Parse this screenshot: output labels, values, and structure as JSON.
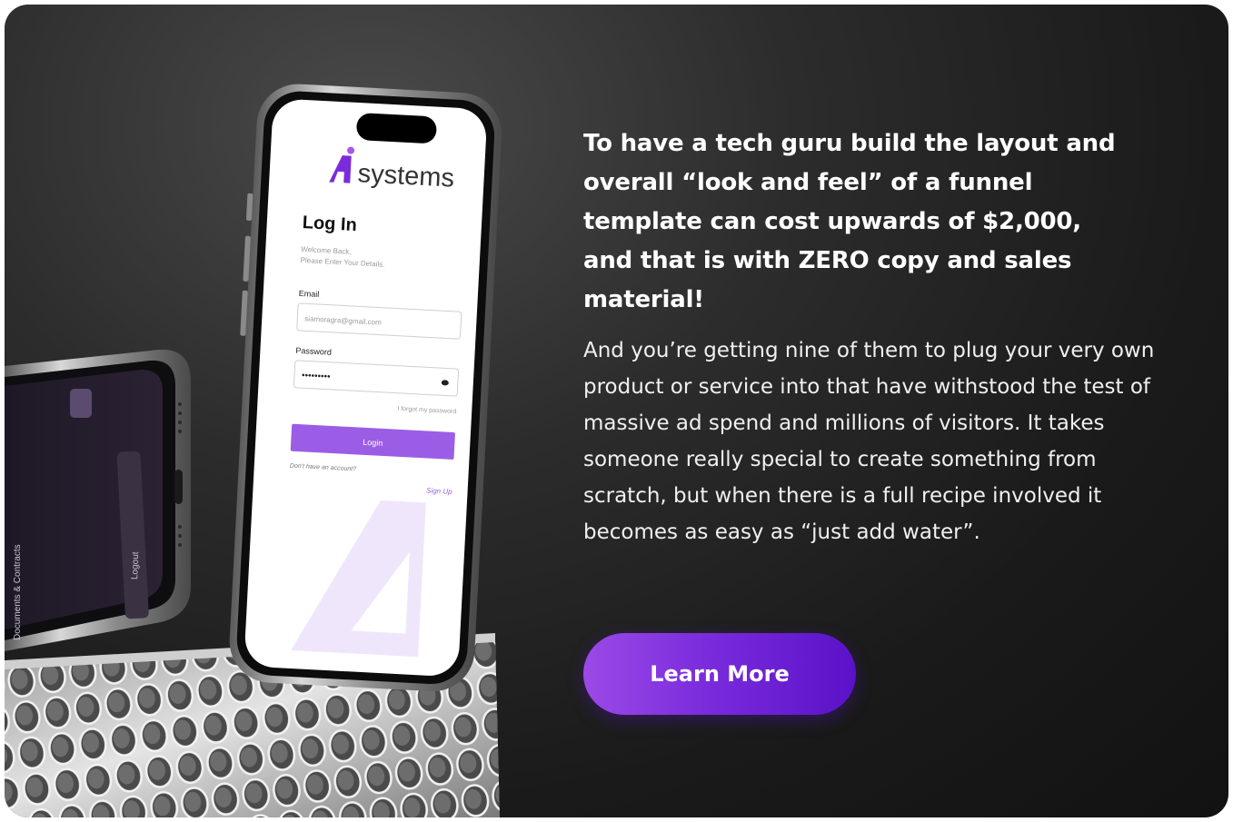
{
  "headline": "To have a tech guru build the layout and overall “look and feel” of a funnel template can cost upwards of $2,000, and that is with ZERO copy and sales material!",
  "body": "And you’re getting nine of them to plug your very own product or service into that have withstood the test of massive ad spend and millions of visitors. It takes someone really special to create something from scratch, but when there is a full recipe involved it becomes as easy as “just add water”.",
  "cta_label": "Learn More",
  "phone_screen": {
    "brand": "systems",
    "title": "Log In",
    "welcome": "Welcome Back,",
    "instructions": "Please Enter Your Details.",
    "email_label": "Email",
    "email_value": "siamoragra@gmail.com",
    "password_label": "Password",
    "password_value": "•••••••••",
    "forgot": "I forgot my password",
    "login_button": "Login",
    "no_account": "Don't have an account?",
    "signup": "Sign Up"
  },
  "back_phone": {
    "menu_item_logout": "Logout",
    "menu_item_docs": "Documents & Contracts"
  },
  "colors": {
    "accent": "#7a2cdc",
    "brand_purple": "#9b5de5",
    "card_background": "#1c1c1c"
  }
}
